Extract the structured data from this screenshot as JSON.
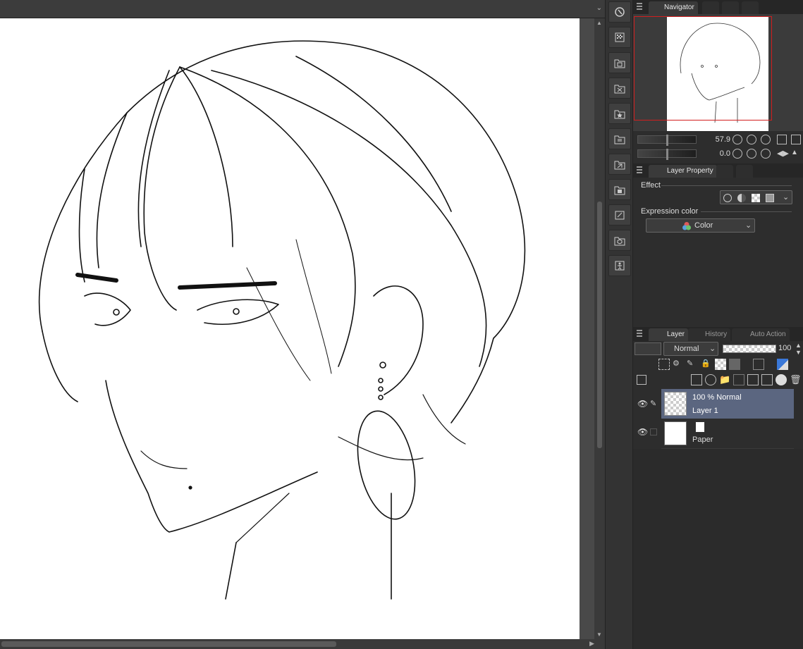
{
  "navigator": {
    "tabs": [
      "Navigator",
      "",
      "",
      ""
    ],
    "zoom_value": "57.9",
    "rotation_value": "0.0"
  },
  "layer_property": {
    "tab_label": "Layer Property",
    "effect_label": "Effect",
    "expression_color_label": "Expression color",
    "expression_color_value": "Color"
  },
  "layer_panel": {
    "tabs": [
      "Layer",
      "History",
      "Auto Action"
    ],
    "blend_mode": "Normal",
    "opacity_value": "100",
    "layers": [
      {
        "mode_text": "100 % Normal",
        "name": "Layer 1",
        "selected": true
      },
      {
        "mode_text": "",
        "name": "Paper",
        "selected": false
      }
    ]
  },
  "colors": {
    "accent_selected_layer": "#5b6680",
    "nav_frame": "#d21e1e",
    "panel_bg": "#2d2d2d"
  },
  "dock_icons": [
    "navigator-dock-icon",
    "texture-dock-icon",
    "material-dock-icon",
    "delete-dock-icon",
    "favorite-dock-icon",
    "layout-dock-icon",
    "transform-dock-icon",
    "image-dock-icon",
    "edit-dock-icon",
    "3d-dock-icon",
    "pose-dock-icon"
  ]
}
